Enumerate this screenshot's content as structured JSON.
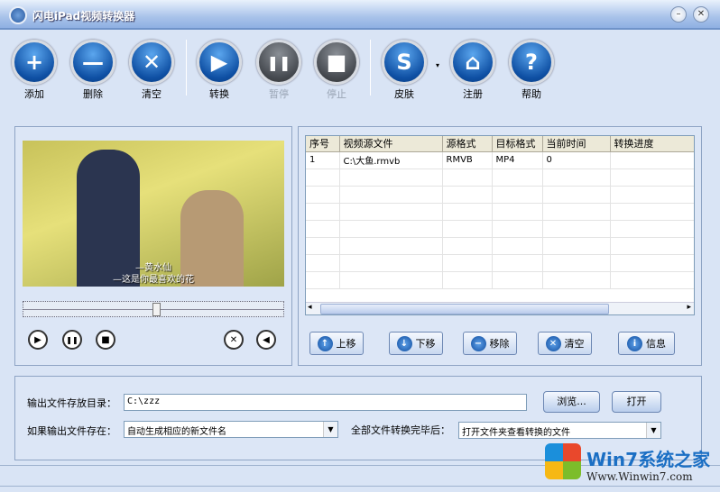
{
  "window": {
    "title": "闪电iPad视频转换器",
    "min": "–",
    "close": "✕"
  },
  "toolbar": [
    {
      "label": "添加",
      "icon": "+"
    },
    {
      "label": "删除",
      "icon": "—"
    },
    {
      "label": "清空",
      "icon": "✕"
    },
    {
      "label": "转换",
      "icon": "▶"
    },
    {
      "label": "暂停",
      "icon": "❚❚"
    },
    {
      "label": "停止",
      "icon": "■"
    },
    {
      "label": "皮肤",
      "icon": "S"
    },
    {
      "label": "注册",
      "icon": "⌂"
    },
    {
      "label": "帮助",
      "icon": "?"
    }
  ],
  "player": {
    "subtitle1": "—黄水仙",
    "subtitle2": "—这是你最喜欢的花",
    "position": 0.51
  },
  "table": {
    "headers": [
      "序号",
      "视频源文件",
      "源格式",
      "目标格式",
      "当前时间",
      "转换进度"
    ],
    "rows": [
      [
        "1",
        "C:\\大鱼.rmvb",
        "RMVB",
        "MP4",
        "0",
        ""
      ]
    ]
  },
  "list_buttons": [
    "上移",
    "下移",
    "移除",
    "清空",
    "信息"
  ],
  "output": {
    "dir_label": "输出文件存放目录：",
    "dir_value": "C:\\zzz",
    "browse": "浏览...",
    "open": "打开",
    "exists_label": "如果输出文件存在：",
    "exists_value": "自动生成相应的新文件名",
    "done_label": "全部文件转换完毕后：",
    "done_value": "打开文件夹查看转换的文件"
  },
  "watermark": {
    "line1": "Win7系统之家",
    "line2": "Www.Winwin7.com"
  }
}
